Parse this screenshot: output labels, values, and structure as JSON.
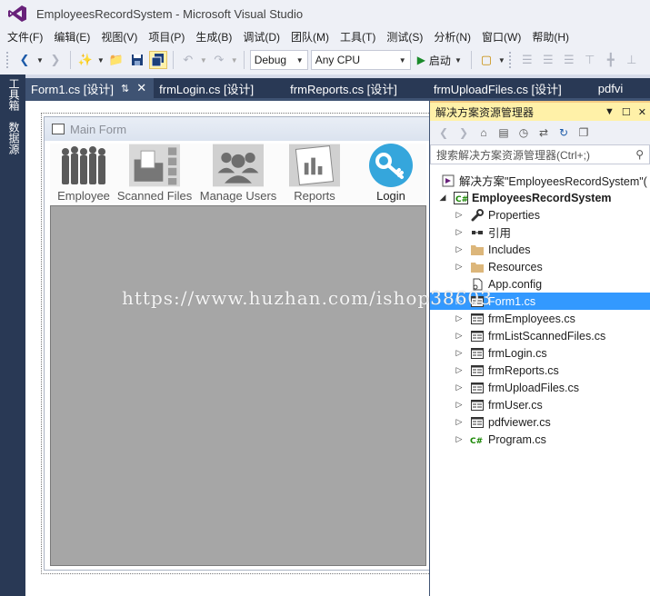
{
  "window": {
    "title": "EmployeesRecordSystem - Microsoft Visual Studio"
  },
  "menu": [
    "文件(F)",
    "编辑(E)",
    "视图(V)",
    "项目(P)",
    "生成(B)",
    "调试(D)",
    "团队(M)",
    "工具(T)",
    "测试(S)",
    "分析(N)",
    "窗口(W)",
    "帮助(H)"
  ],
  "toolbar": {
    "config": "Debug",
    "platform": "Any CPU",
    "start_label": "启动"
  },
  "side_tabs": [
    "工具箱",
    "数据源"
  ],
  "doc_tabs": [
    {
      "label": "Form1.cs [设计]",
      "active": true
    },
    {
      "label": "frmLogin.cs [设计]",
      "active": false
    },
    {
      "label": "frmReports.cs [设计]",
      "active": false
    },
    {
      "label": "frmUploadFiles.cs [设计]",
      "active": false
    },
    {
      "label": "pdfvi",
      "active": false
    }
  ],
  "designer": {
    "form_title": "Main Form",
    "buttons": [
      {
        "label": "Employee",
        "icon": "people-group-icon"
      },
      {
        "label": "Scanned Files",
        "icon": "folder-documents-icon"
      },
      {
        "label": "Manage Users",
        "icon": "users-icon"
      },
      {
        "label": "Reports",
        "icon": "report-chart-icon"
      },
      {
        "label": "Login",
        "icon": "key-icon"
      }
    ]
  },
  "solution_explorer": {
    "title": "解决方案资源管理器",
    "search_placeholder": "搜索解决方案资源管理器(Ctrl+;)",
    "solution_label": "解决方案\"EmployeesRecordSystem\"(",
    "project_label": "EmployeesRecordSystem",
    "items": [
      {
        "label": "Properties",
        "icon": "wrench-icon",
        "expandable": true,
        "selected": false
      },
      {
        "label": "引用",
        "icon": "references-icon",
        "expandable": true,
        "selected": false
      },
      {
        "label": "Includes",
        "icon": "folder-icon",
        "expandable": true,
        "selected": false
      },
      {
        "label": "Resources",
        "icon": "folder-icon",
        "expandable": true,
        "selected": false
      },
      {
        "label": "App.config",
        "icon": "config-file-icon",
        "expandable": false,
        "selected": false
      },
      {
        "label": "Form1.cs",
        "icon": "form-icon",
        "expandable": true,
        "selected": true
      },
      {
        "label": "frmEmployees.cs",
        "icon": "form-icon",
        "expandable": true,
        "selected": false
      },
      {
        "label": "frmListScannedFiles.cs",
        "icon": "form-icon",
        "expandable": true,
        "selected": false
      },
      {
        "label": "frmLogin.cs",
        "icon": "form-icon",
        "expandable": true,
        "selected": false
      },
      {
        "label": "frmReports.cs",
        "icon": "form-icon",
        "expandable": true,
        "selected": false
      },
      {
        "label": "frmUploadFiles.cs",
        "icon": "form-icon",
        "expandable": true,
        "selected": false
      },
      {
        "label": "frmUser.cs",
        "icon": "form-icon",
        "expandable": true,
        "selected": false
      },
      {
        "label": "pdfviewer.cs",
        "icon": "form-icon",
        "expandable": true,
        "selected": false
      },
      {
        "label": "Program.cs",
        "icon": "csharp-file-icon",
        "expandable": true,
        "selected": false
      }
    ]
  },
  "watermark": "https://www.huzhan.com/ishop38603"
}
